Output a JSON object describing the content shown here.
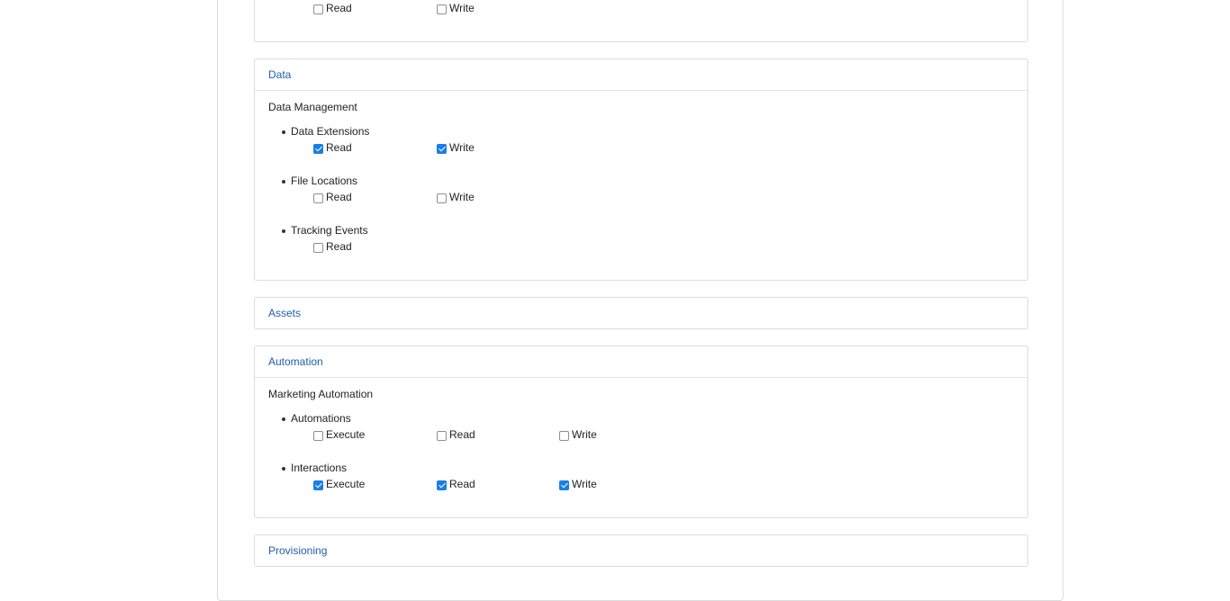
{
  "top_partial": {
    "perms": [
      {
        "label": "Read",
        "checked": false
      },
      {
        "label": "Write",
        "checked": false
      }
    ]
  },
  "sections": {
    "data": {
      "title": "Data",
      "group": "Data Management",
      "items": [
        {
          "label": "Data Extensions",
          "perms": [
            {
              "label": "Read",
              "checked": true
            },
            {
              "label": "Write",
              "checked": true
            }
          ]
        },
        {
          "label": "File Locations",
          "perms": [
            {
              "label": "Read",
              "checked": false
            },
            {
              "label": "Write",
              "checked": false
            }
          ]
        },
        {
          "label": "Tracking Events",
          "perms": [
            {
              "label": "Read",
              "checked": false
            }
          ]
        }
      ]
    },
    "assets": {
      "title": "Assets"
    },
    "automation": {
      "title": "Automation",
      "group": "Marketing Automation",
      "items": [
        {
          "label": "Automations",
          "perms": [
            {
              "label": "Execute",
              "checked": false
            },
            {
              "label": "Read",
              "checked": false
            },
            {
              "label": "Write",
              "checked": false
            }
          ]
        },
        {
          "label": "Interactions",
          "perms": [
            {
              "label": "Execute",
              "checked": true
            },
            {
              "label": "Read",
              "checked": true
            },
            {
              "label": "Write",
              "checked": true
            }
          ]
        }
      ]
    },
    "provisioning": {
      "title": "Provisioning"
    }
  }
}
